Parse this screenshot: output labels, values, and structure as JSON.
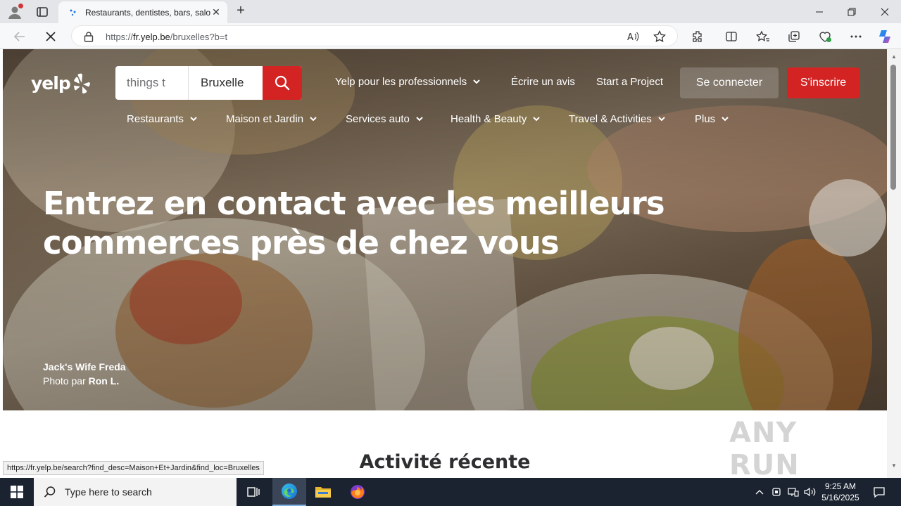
{
  "browser": {
    "tab_title": "Restaurants, dentistes, bars, salon",
    "url_prefix": "https://",
    "url_host": "fr.yelp.be",
    "url_path": "/bruxelles?b=t",
    "status_url": "https://fr.yelp.be/search?find_desc=Maison+Et+Jardin&find_loc=Bruxelles"
  },
  "yelp": {
    "logo": "yelp",
    "search_what": "things t",
    "search_where": "Bruxelle",
    "nav": {
      "for_business": "Yelp pour les professionnels",
      "write_review": "Écrire un avis",
      "start_project": "Start a Project",
      "login": "Se connecter",
      "signup": "S'inscrire"
    },
    "categories": [
      {
        "label": "Restaurants"
      },
      {
        "label": "Maison et Jardin"
      },
      {
        "label": "Services auto"
      },
      {
        "label": "Health & Beauty"
      },
      {
        "label": "Travel & Activities"
      },
      {
        "label": "Plus"
      }
    ],
    "headline_line1": "Entrez en contact avec les meilleurs",
    "headline_line2": "commerces près de chez vous",
    "photo_business": "Jack's Wife Freda",
    "photo_by_label": "Photo par",
    "photo_author": "Ron L.",
    "section_title": "Activité récente"
  },
  "watermark": "ANY RUN",
  "taskbar": {
    "search_placeholder": "Type here to search",
    "time": "9:25 AM",
    "date": "5/16/2025"
  },
  "colors": {
    "yelp_red": "#d32323",
    "taskbar": "#1b2330"
  }
}
